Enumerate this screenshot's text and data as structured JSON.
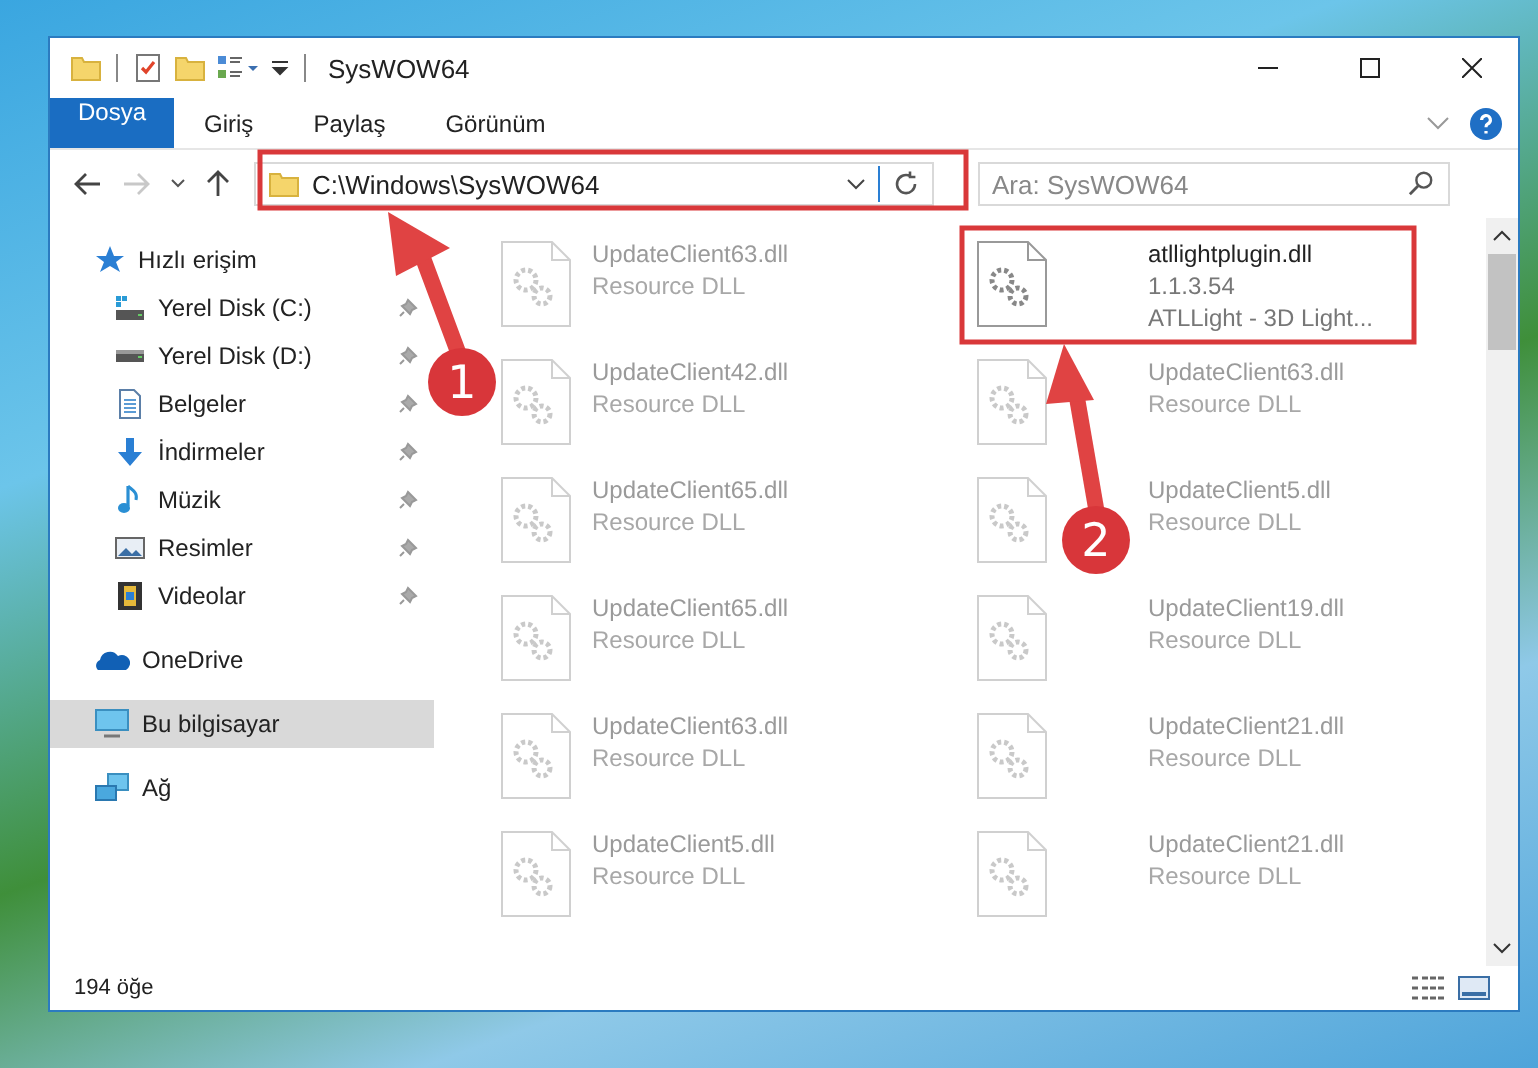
{
  "window": {
    "title": "SysWOW64"
  },
  "ribbon_tabs": [
    {
      "label": "Dosya",
      "kind": "file",
      "selected": false
    },
    {
      "label": "Giriş",
      "kind": "tab",
      "selected": false
    },
    {
      "label": "Paylaş",
      "kind": "tab",
      "selected": false
    },
    {
      "label": "Görünüm",
      "kind": "tab",
      "selected": false
    }
  ],
  "address_bar": {
    "path": "C:\\Windows\\SysWOW64",
    "forward_disabled": true
  },
  "search": {
    "placeholder": "Ara: SysWOW64"
  },
  "sidebar": {
    "items": [
      {
        "label": "Hızlı erişim",
        "kind": "star",
        "selected": false,
        "children": [
          {
            "label": "Yerel Disk (C:)",
            "kind": "system-drive",
            "pinned": true,
            "selected": false
          },
          {
            "label": "Yerel Disk (D:)",
            "kind": "drive",
            "pinned": true,
            "selected": false
          },
          {
            "label": "Belgeler",
            "kind": "document",
            "pinned": true,
            "selected": false
          },
          {
            "label": "İndirmeler",
            "kind": "download",
            "pinned": true,
            "selected": false
          },
          {
            "label": "Müzik",
            "kind": "music",
            "pinned": true,
            "selected": false
          },
          {
            "label": "Resimler",
            "kind": "picture",
            "pinned": true,
            "selected": false
          },
          {
            "label": "Videolar",
            "kind": "video",
            "pinned": true,
            "selected": false
          }
        ]
      },
      {
        "label": "OneDrive",
        "kind": "cloud",
        "selected": false
      },
      {
        "label": "Bu bilgisayar",
        "kind": "computer",
        "selected": true
      },
      {
        "label": "Ağ",
        "kind": "network",
        "selected": false
      }
    ]
  },
  "files": [
    {
      "name": "UpdateClient63.dll",
      "lines": [
        "Resource DLL"
      ],
      "faded": true
    },
    {
      "name": "atllightplugin.dll",
      "lines": [
        "1.1.3.54",
        "ATLLight - 3D Light..."
      ],
      "faded": false
    },
    {
      "name": "UpdateClient42.dll",
      "lines": [
        "Resource DLL"
      ],
      "faded": true
    },
    {
      "name": "UpdateClient63.dll",
      "lines": [
        "Resource DLL"
      ],
      "faded": true
    },
    {
      "name": "UpdateClient65.dll",
      "lines": [
        "Resource DLL"
      ],
      "faded": true
    },
    {
      "name": "UpdateClient5.dll",
      "lines": [
        "Resource DLL"
      ],
      "faded": true
    },
    {
      "name": "UpdateClient65.dll",
      "lines": [
        "Resource DLL"
      ],
      "faded": true
    },
    {
      "name": "UpdateClient19.dll",
      "lines": [
        "Resource DLL"
      ],
      "faded": true
    },
    {
      "name": "UpdateClient63.dll",
      "lines": [
        "Resource DLL"
      ],
      "faded": true
    },
    {
      "name": "UpdateClient21.dll",
      "lines": [
        "Resource DLL"
      ],
      "faded": true
    },
    {
      "name": "UpdateClient5.dll",
      "lines": [
        "Resource DLL"
      ],
      "faded": true
    },
    {
      "name": "UpdateClient21.dll",
      "lines": [
        "Resource DLL"
      ],
      "faded": true
    }
  ],
  "status_bar": {
    "count": "194 öğe"
  },
  "annotations": [
    {
      "label": "1"
    },
    {
      "label": "2"
    }
  ]
}
